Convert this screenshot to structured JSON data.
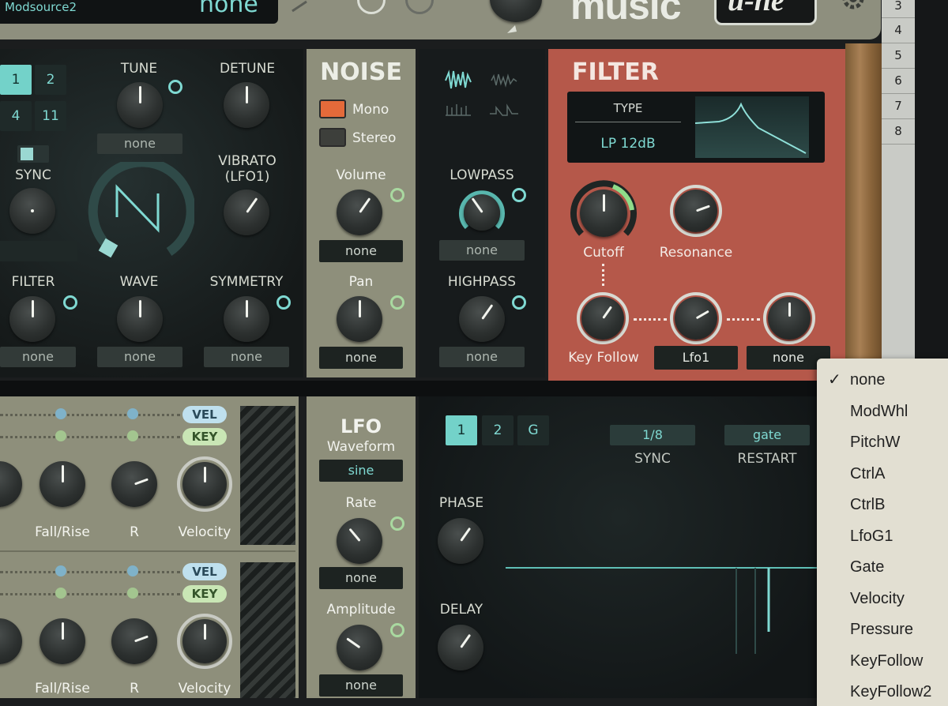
{
  "top": {
    "mod_source_label": "Modsource2",
    "mod_source_value": "none",
    "brand_text": "music",
    "brand_badge": "u-he"
  },
  "right_numbers": [
    "3",
    "4",
    "5",
    "6",
    "7",
    "8"
  ],
  "osc": {
    "buttons": [
      "1",
      "2",
      "4",
      "11"
    ],
    "tune": "TUNE",
    "detune": "DETUNE",
    "tune_mod": "none",
    "sync": "SYNC",
    "vibrato": "VIBRATO\n(LFO1)",
    "filter": "FILTER",
    "wave": "WAVE",
    "symmetry": "SYMMETRY",
    "filter_mod": "none",
    "wave_mod": "none",
    "symmetry_mod": "none"
  },
  "noise": {
    "title": "NOISE",
    "mono": "Mono",
    "stereo": "Stereo",
    "volume": "Volume",
    "volume_mod": "none",
    "pan": "Pan",
    "pan_mod": "none"
  },
  "noise_filter": {
    "lowpass": "LOWPASS",
    "lowpass_mod": "none",
    "highpass": "HIGHPASS",
    "highpass_mod": "none"
  },
  "filter": {
    "title": "FILTER",
    "type_label": "TYPE",
    "type_value": "LP 12dB",
    "cutoff": "Cutoff",
    "resonance": "Resonance",
    "key_follow": "Key Follow",
    "mod1": "Lfo1",
    "mod2": "none"
  },
  "env": {
    "vel": "VEL",
    "key": "KEY",
    "fall_rise": "Fall/Rise",
    "r": "R",
    "velocity": "Velocity"
  },
  "lfo": {
    "title": "LFO",
    "waveform": "Waveform",
    "waveform_value": "sine",
    "rate": "Rate",
    "rate_mod": "none",
    "amplitude": "Amplitude",
    "amplitude_mod": "none"
  },
  "lfo_panel": {
    "tabs": [
      "1",
      "2",
      "G"
    ],
    "sync_value": "1/8",
    "sync_label": "SYNC",
    "restart_value": "gate",
    "restart_label": "RESTART",
    "phase": "PHASE",
    "delay": "DELAY"
  },
  "dropdown": {
    "selected": "none",
    "items": [
      "none",
      "ModWhl",
      "PitchW",
      "CtrlA",
      "CtrlB",
      "LfoG1",
      "Gate",
      "Velocity",
      "Pressure",
      "KeyFollow",
      "KeyFollow2"
    ]
  },
  "colors": {
    "teal": "#73d2c9",
    "filter_red": "#b5584a",
    "panel_olive": "#8e8f7b",
    "dark_panel": "#1d2122"
  }
}
